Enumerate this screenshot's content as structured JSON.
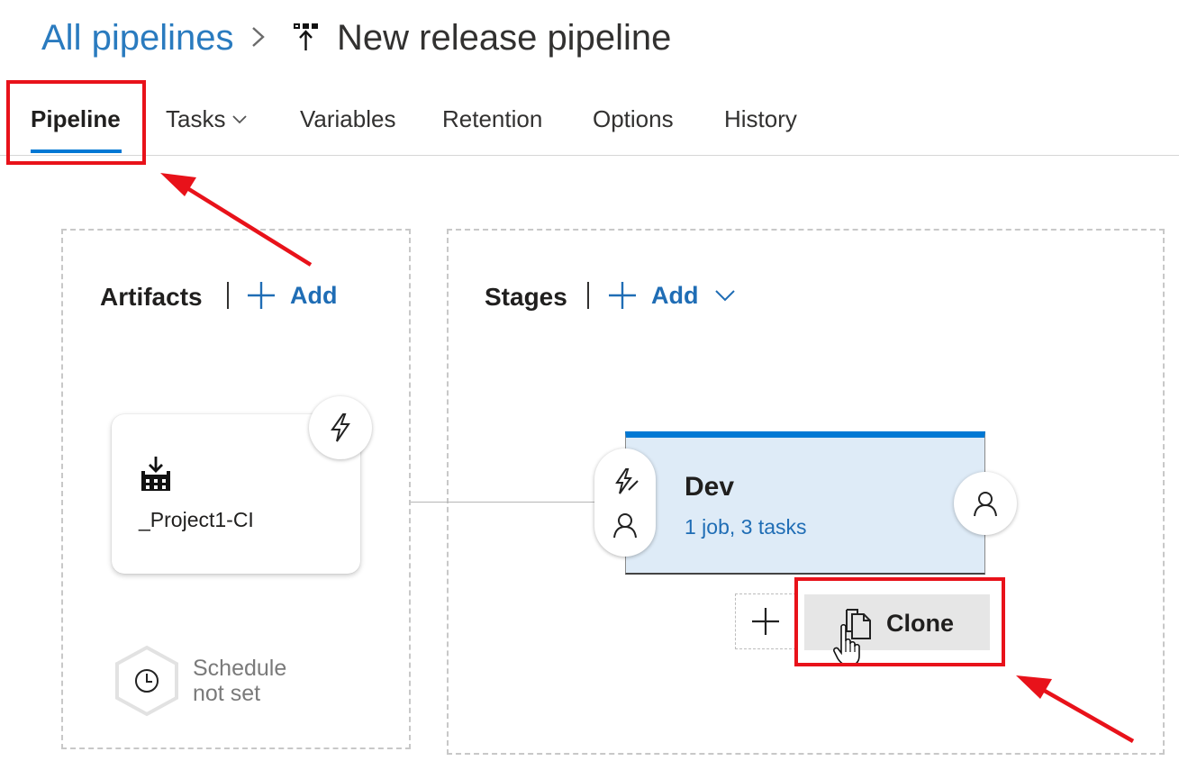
{
  "breadcrumb": {
    "root": "All pipelines",
    "separator_icon": "chevron-right-icon",
    "pipeline_icon": "release-pipeline-icon",
    "title": "New release pipeline"
  },
  "tabs": [
    {
      "label": "Pipeline",
      "active": true
    },
    {
      "label": "Tasks",
      "has_dropdown": true
    },
    {
      "label": "Variables"
    },
    {
      "label": "Retention"
    },
    {
      "label": "Options"
    },
    {
      "label": "History"
    }
  ],
  "artifacts": {
    "title": "Artifacts",
    "add_label": "Add",
    "card": {
      "name": "_Project1-CI",
      "icon": "build-artifact-icon",
      "trigger_icon": "lightning-icon"
    },
    "schedule": {
      "icon": "clock-icon",
      "line1": "Schedule",
      "line2": "not set"
    }
  },
  "stages": {
    "title": "Stages",
    "add_label": "Add",
    "stage": {
      "name": "Dev",
      "summary": "1 job, 3 tasks",
      "pre_icons": [
        "pre-deployment-trigger-icon",
        "pre-approver-icon"
      ],
      "post_icon": "post-approver-icon"
    },
    "clone_label": "Clone"
  },
  "colors": {
    "accent": "#0078d4",
    "link": "#1f6db5",
    "stage_fill": "#deebf7",
    "annotation_red": "#e8121a"
  }
}
